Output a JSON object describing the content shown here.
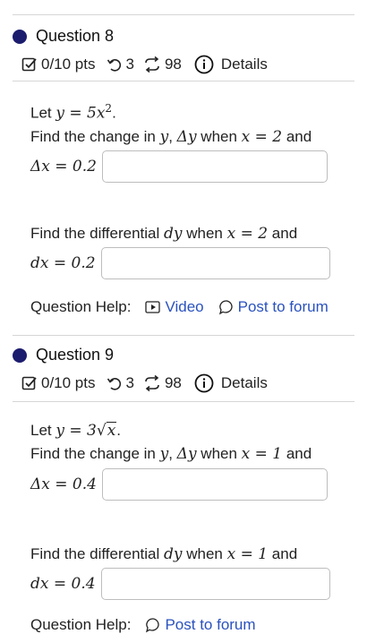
{
  "q8": {
    "title": "Question 8",
    "pts": "0/10 pts",
    "attempts": "3",
    "retries": "98",
    "details": "Details",
    "part1": {
      "intro_let": "Let ",
      "intro_eq": "y = 5x",
      "intro_exp": "2",
      "intro_end": ".",
      "line1_a": "Find the change in ",
      "line1_y": "y",
      "line1_b": ", ",
      "line1_dy": "Δy",
      "line1_c": " when ",
      "line1_x": "x = 2",
      "line1_d": " and",
      "line2": "Δx = 0.2"
    },
    "part2": {
      "line1_a": "Find the differential ",
      "line1_dy": "dy",
      "line1_b": " when ",
      "line1_x": "x = 2",
      "line1_c": " and",
      "line2": "dx = 0.2"
    },
    "help_label": "Question Help:",
    "video_label": "Video",
    "forum_label": "Post to forum"
  },
  "q9": {
    "title": "Question 9",
    "pts": "0/10 pts",
    "attempts": "3",
    "retries": "98",
    "details": "Details",
    "part1": {
      "intro_let": "Let ",
      "intro_eq": "y = 3",
      "intro_rad": "x",
      "intro_end": ".",
      "line1_a": "Find the change in ",
      "line1_y": "y",
      "line1_b": ", ",
      "line1_dy": "Δy",
      "line1_c": " when ",
      "line1_x": "x = 1",
      "line1_d": " and",
      "line2": "Δx = 0.4"
    },
    "part2": {
      "line1_a": "Find the differential ",
      "line1_dy": "dy",
      "line1_b": " when ",
      "line1_x": "x = 1",
      "line1_c": " and",
      "line2": "dx = 0.4"
    },
    "help_label": "Question Help:",
    "forum_label": "Post to forum"
  },
  "colors": {
    "accent": "#1c1c6e",
    "link": "#2a52be",
    "rule": "#d6d6d6"
  },
  "icons": [
    "checkbox-icon",
    "undo-icon",
    "retry-icon",
    "info-icon",
    "video-icon",
    "comment-icon"
  ]
}
